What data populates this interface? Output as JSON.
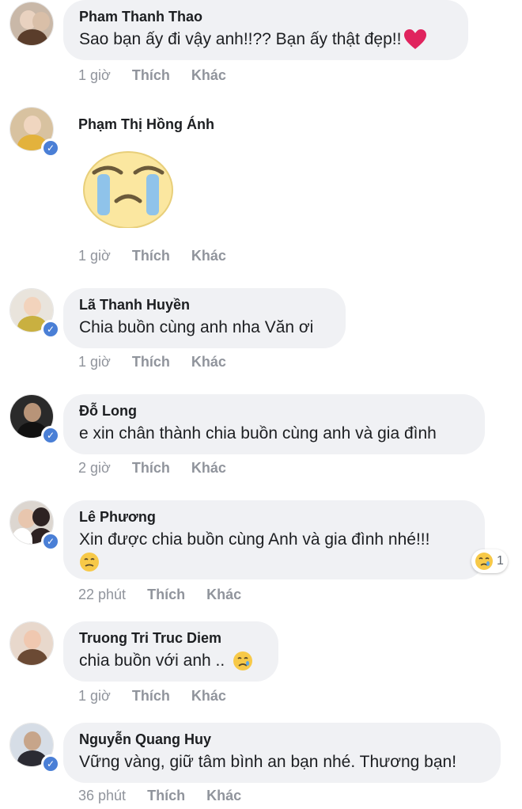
{
  "comments": [
    {
      "author": "Pham Thanh Thao",
      "text": "Sao bạn ấy đi vậy anh!!?? Bạn ấy thật đẹp!!",
      "emoji": "heart-icon",
      "time": "1 giờ",
      "like": "Thích",
      "more": "Khác",
      "verified": false,
      "avatar_colors": [
        "#c9b8a8",
        "#5a3d2b",
        "#e9d2c0"
      ]
    },
    {
      "author": "Phạm Thị Hồng Ánh",
      "text": "",
      "sticker": "crying-face-sticker",
      "time": "1 giờ",
      "like": "Thích",
      "more": "Khác",
      "verified": true,
      "avatar_colors": [
        "#d8c2a0",
        "#3b2a1f",
        "#e3b23c"
      ]
    },
    {
      "author": "Lã Thanh Huyền",
      "text": "Chia buồn cùng anh nha Văn ơi",
      "time": "1 giờ",
      "like": "Thích",
      "more": "Khác",
      "verified": true,
      "avatar_colors": [
        "#e9e4dc",
        "#8b5a3c",
        "#c9b040"
      ]
    },
    {
      "author": "Đỗ Long",
      "text": "e xin chân thành chia buồn cùng anh và gia đình",
      "time": "2 giờ",
      "like": "Thích",
      "more": "Khác",
      "verified": true,
      "avatar_colors": [
        "#2a2a2a",
        "#1a1a1a",
        "#3a3a3a"
      ]
    },
    {
      "author": "Lê Phương",
      "text": "Xin được chia buồn cùng Anh và gia đình nhé!!!",
      "emoji": "sad-face-icon",
      "time": "22 phút",
      "like": "Thích",
      "more": "Khác",
      "verified": true,
      "reaction_icon": "sad-reaction-icon",
      "reaction_count": "1",
      "avatar_colors": [
        "#dcd6d0",
        "#2d2222",
        "#ffffff"
      ]
    },
    {
      "author": "Truong Tri Truc Diem",
      "text": "chia buồn với anh ..",
      "emoji": "crying-face-icon",
      "time": "1 giờ",
      "like": "Thích",
      "more": "Khác",
      "verified": false,
      "avatar_colors": [
        "#e8d8cc",
        "#6b4a34",
        "#f0c8b0"
      ]
    },
    {
      "author": "Nguyễn Quang Huy",
      "text": "Vững vàng, giữ tâm bình an bạn nhé. Thương bạn!",
      "time": "36 phút",
      "like": "Thích",
      "more": "Khác",
      "verified": true,
      "avatar_colors": [
        "#d6dde6",
        "#2b2b33",
        "#c7a58a"
      ]
    }
  ],
  "colors": {
    "bubble": "#f0f1f4",
    "meta_text": "#90949c",
    "verified_badge": "#4a7fd6",
    "heart": "#e0245e",
    "emoji_yellow": "#f7c948"
  }
}
